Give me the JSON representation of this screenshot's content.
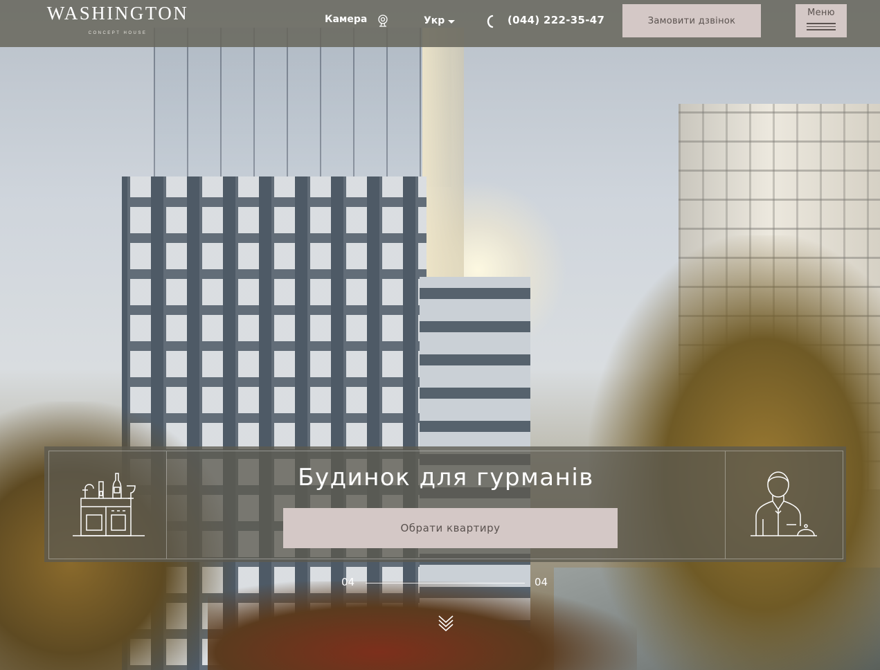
{
  "header": {
    "logo_main": "WASHINGTON",
    "logo_sub": "CONCEPT HOUSE",
    "camera_label": "Камера",
    "camera_icon": "webcam-icon",
    "language": "Укр",
    "phone_icon": "phone-icon",
    "phone": "(044) 222-35-47",
    "callback_label": "Замовити дзвінок",
    "menu_label": "Меню",
    "menu_icon": "hamburger-icon"
  },
  "promo": {
    "title": "Будинок для гурманів",
    "cta_label": "Обрати квартиру",
    "left_icon": "kitchen-icon",
    "right_icon": "waiter-icon"
  },
  "slider": {
    "current": "04",
    "total": "04",
    "scroll_icon": "chevron-double-down-icon"
  },
  "colors": {
    "header_bg": "#68665c",
    "button_bg": "#d4c8c6",
    "button_text": "#5a524f",
    "text": "#ffffff"
  }
}
